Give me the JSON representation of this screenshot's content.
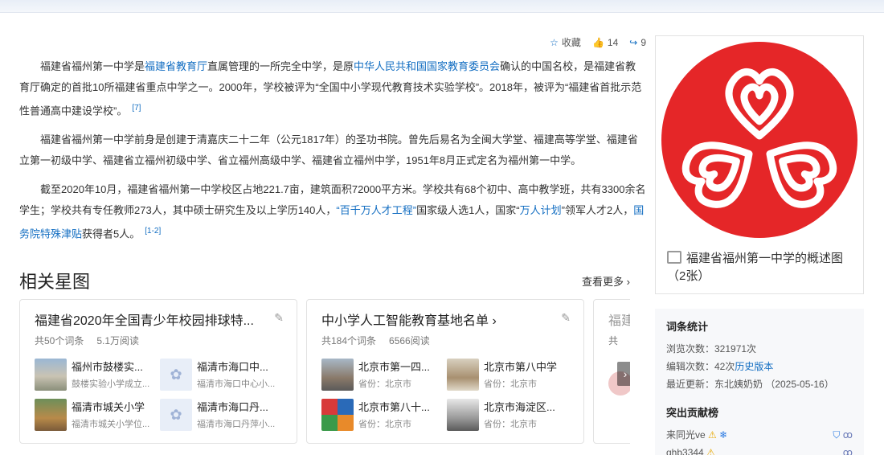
{
  "actions": {
    "fav_label": "收藏",
    "like_count": "14",
    "share_count": "9"
  },
  "paragraphs": {
    "p1": {
      "t1": "福建省福州第一中学是",
      "l1": "福建省教育厅",
      "t2": "直属管理的一所完全中学，是原",
      "l2": "中华人民共和国国家教育委员会",
      "t3": "确认的中国名校，是福建省教育厅确定的首批10所福建省重点中学之一。2000年，学校被评为“全国中小学现代教育技术实验学校”。2018年，被评为“福建省首批示范性普通高中建设学校”。",
      "ref": "[7]"
    },
    "p2": {
      "t1": "福建省福州第一中学前身是创建于清嘉庆二十二年（公元1817年）的圣功书院。曾先后易名为全闽大学堂、福建高等学堂、福建省立第一初级中学、福建省立福州初级中学、省立福州高级中学、福建省立福州中学，1951年8月正式定名为福州第一中学。"
    },
    "p3": {
      "t1": "截至2020年10月，福建省福州第一中学校区占地221.7亩，建筑面积72000平方米。学校共有68个初中、高中教学班，共有3300余名学生；学校共有专任教师273人，其中硕士研究生及以上学历140人，",
      "l1": "“百千万人才工程”",
      "t2": "国家级人选1人，国家“",
      "l2": "万人计划",
      "t3": "”领军人才2人，",
      "l3": "国务院特殊津贴",
      "t4": "获得者5人。",
      "ref": "[1-2]"
    }
  },
  "section": {
    "title": "相关星图",
    "more": "查看更多 ›"
  },
  "cards": [
    {
      "title": "福建省2020年全国青少年校园排球特...",
      "entries": "共50个词条",
      "views": "5.1万阅读",
      "items": [
        {
          "name": "福州市鼓楼实...",
          "sub": "鼓楼实验小学成立..."
        },
        {
          "name": "福清市海口中...",
          "sub": "福清市海口中心小..."
        },
        {
          "name": "福清市城关小学",
          "sub": "福清市城关小学位..."
        },
        {
          "name": "福清市海口丹...",
          "sub": "福清市海口丹萍小..."
        }
      ]
    },
    {
      "title": "中小学人工智能教育基地名单 ›",
      "entries": "共184个词条",
      "views": "6566阅读",
      "items": [
        {
          "name": "北京市第一四...",
          "sub": "省份：北京市"
        },
        {
          "name": "北京市第八中学",
          "sub": "省份：北京市"
        },
        {
          "name": "北京市第八十...",
          "sub": "省份：北京市"
        },
        {
          "name": "北京市海淀区...",
          "sub": "省份：北京市"
        }
      ]
    },
    {
      "title": "福建",
      "entries": "共",
      "views": ""
    }
  ],
  "side": {
    "logo_caption": "福建省福州第一中学的概述图（2张）",
    "stats_title": "词条统计",
    "views": "浏览次数：321971次",
    "edits_prefix": "编辑次数：42次",
    "edits_link": "历史版本",
    "updated": "最近更新：东北姨奶奶 （2025-05-16）",
    "contrib_title": "突出贡献榜",
    "contrib1": "来同光ve",
    "contrib2": "qhb3344"
  },
  "colors": {
    "link": "#136ec2",
    "logo_red": "#e52628"
  }
}
